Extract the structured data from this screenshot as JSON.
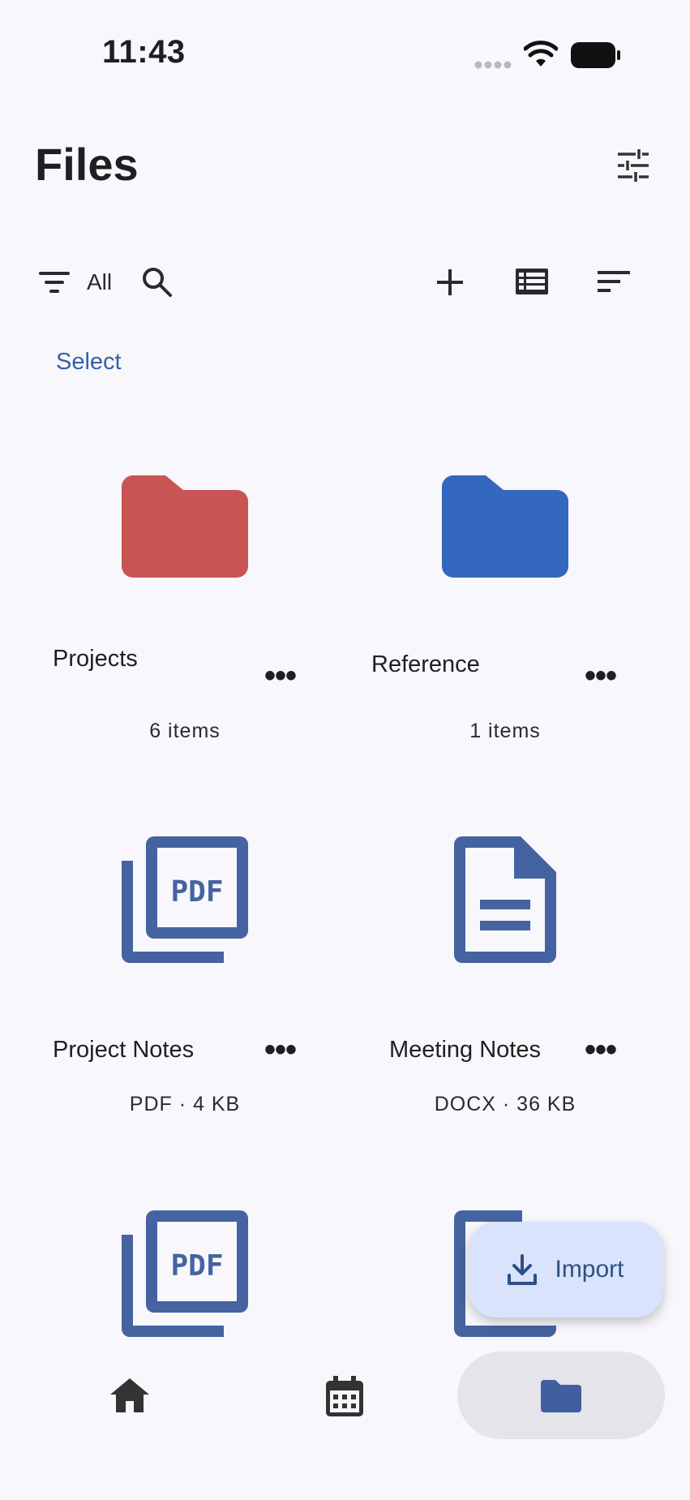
{
  "status_bar": {
    "time": "11:43"
  },
  "header": {
    "title": "Files"
  },
  "toolbar": {
    "filter_label": "All"
  },
  "select_label": "Select",
  "items": [
    {
      "name": "Projects",
      "meta": "6 items",
      "icon": "folder-icon",
      "color": "#c95454"
    },
    {
      "name": "Reference",
      "meta": "1 items",
      "icon": "folder-icon",
      "color": "#3468bf"
    },
    {
      "name": "Project Notes",
      "meta": "PDF · 4 KB",
      "icon": "pdf-icon",
      "color": "#4663a1"
    },
    {
      "name": "Meeting Notes",
      "meta": "DOCX · 36 KB",
      "icon": "document-icon",
      "color": "#4663a1"
    }
  ],
  "more_glyph": "•••",
  "fab": {
    "label": "Import"
  },
  "bottom_nav": {
    "items": [
      {
        "icon": "home-icon"
      },
      {
        "icon": "calendar-icon"
      },
      {
        "icon": "folder-icon",
        "active": true
      }
    ]
  },
  "colors": {
    "accent": "#3561a8",
    "file_icon": "#4663a1",
    "fab_bg": "#d9e3fb"
  }
}
